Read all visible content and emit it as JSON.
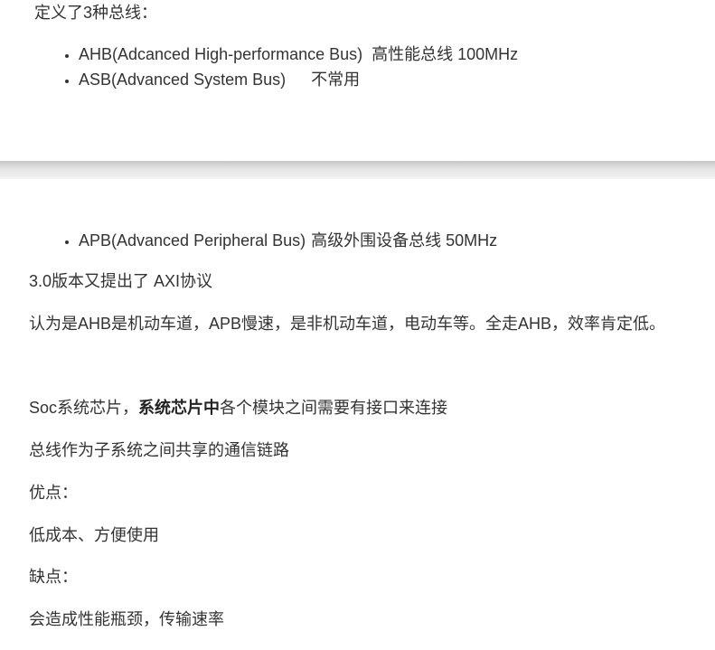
{
  "intro": "定义了3种总线：",
  "bus_list_top": [
    {
      "name": "AHB(Adcanced High-performance Bus)",
      "desc": "高性能总线 100MHz"
    },
    {
      "name": "ASB(Advanced System Bus)",
      "desc": "不常用"
    }
  ],
  "bus_list_bottom": [
    {
      "name": "APB(Advanced Peripheral Bus)",
      "desc": "高级外围设备总线   50MHz"
    }
  ],
  "paragraphs": {
    "axi": "3.0版本又提出了 AXI协议",
    "analogy": "认为是AHB是机动车道，APB慢速，是非机动车道，电动车等。全走AHB，效率肯定低。",
    "soc_prefix": "Soc系统芯片，",
    "soc_bold": "系统芯片中",
    "soc_suffix": "各个模块之间需要有接口来连接",
    "bus_role": "总线作为子系统之间共享的通信链路",
    "pros_label": "优点：",
    "pros": "低成本、方便使用",
    "cons_label": "缺点：",
    "cons": "会造成性能瓶颈，传输速率"
  }
}
